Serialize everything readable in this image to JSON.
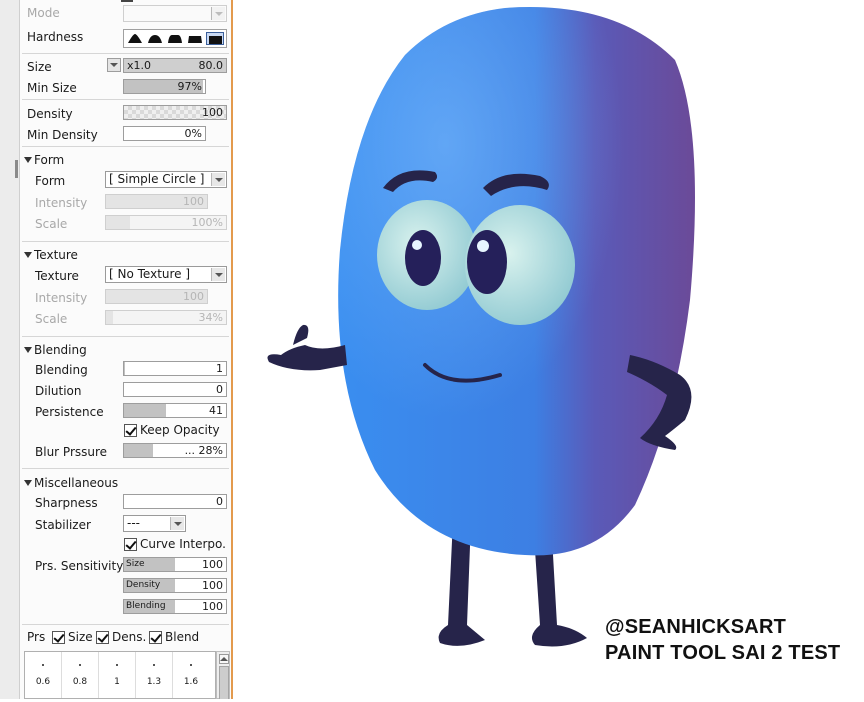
{
  "brush_panel": {
    "mode": {
      "label": "Mode",
      "value": ""
    },
    "hardness": {
      "label": "Hardness",
      "selected_index": 4,
      "shape_icons": [
        "hardness-soft-icon",
        "hardness-medium-soft-icon",
        "hardness-medium-icon",
        "hardness-hard-icon",
        "hardness-square-icon"
      ]
    },
    "size": {
      "label": "Size",
      "multiplier": "x1.0",
      "value": "80.0"
    },
    "min_size": {
      "label": "Min Size",
      "value": "97%",
      "level": 0.97
    },
    "density": {
      "label": "Density",
      "value": "100"
    },
    "min_density": {
      "label": "Min Density",
      "value": "0%"
    },
    "form": {
      "section_label": "Form",
      "form_label": "Form",
      "form_value": "[ Simple Circle ]",
      "intensity_label": "Intensity",
      "intensity_value": "100",
      "scale_label": "Scale",
      "scale_value": "100%"
    },
    "texture": {
      "section_label": "Texture",
      "texture_label": "Texture",
      "texture_value": "[ No Texture ]",
      "intensity_label": "Intensity",
      "intensity_value": "100",
      "scale_label": "Scale",
      "scale_value": "34%"
    },
    "blending": {
      "section_label": "Blending",
      "blending_label": "Blending",
      "blending_value": "1",
      "dilution_label": "Dilution",
      "dilution_value": "0",
      "persistence_label": "Persistence",
      "persistence_value": "41",
      "persistence_level": 0.41,
      "keep_opacity_label": "Keep Opacity",
      "keep_opacity_checked": true,
      "blur_label": "Blur Prssure",
      "blur_value": "... 28%",
      "blur_level": 0.28
    },
    "misc": {
      "section_label": "Miscellaneous",
      "sharpness_label": "Sharpness",
      "sharpness_value": "0",
      "stabilizer_label": "Stabilizer",
      "stabilizer_value": "---",
      "curve_label": "Curve Interpo.",
      "curve_checked": true,
      "prs_sens_label": "Prs. Sensitivity",
      "sens_size_label": "Size",
      "sens_size_value": "100",
      "sens_density_label": "Density",
      "sens_density_value": "100",
      "sens_blending_label": "Blending",
      "sens_blending_value": "100"
    },
    "prs": {
      "label": "Prs",
      "size_label": "Size",
      "dens_label": "Dens.",
      "blend_label": "Blend"
    },
    "sensitivity_points": [
      "0.6",
      "0.8",
      "1",
      "1.3",
      "1.6"
    ]
  },
  "artwork": {
    "credit_line1": "@SEANHICKSART",
    "credit_line2": "PAINT TOOL SAI 2 TEST",
    "body_color": "#3d86e6",
    "shade_color": "#6b4fa0"
  }
}
